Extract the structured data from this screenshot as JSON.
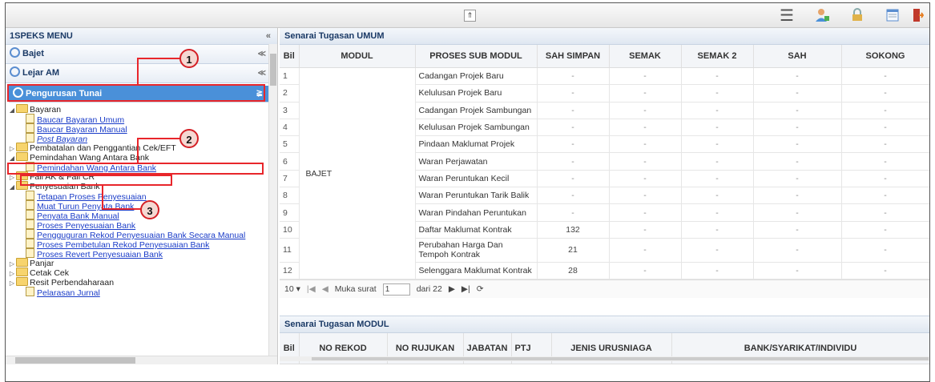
{
  "sidebar": {
    "title": "1SPEKS MENU",
    "collapse_glyph": "«",
    "accordions": [
      {
        "label": "Bajet",
        "icon": "search-icon"
      },
      {
        "label": "Lejar AM",
        "icon": "search-icon"
      },
      {
        "label": "Pengurusan Tunai",
        "icon": "search-icon"
      }
    ],
    "tree": [
      {
        "label": "Bayaran",
        "type": "folder",
        "level": 1,
        "expanded": true
      },
      {
        "label": "Baucar Bayaran Umum",
        "type": "doc",
        "level": 2
      },
      {
        "label": "Baucar Bayaran Manual",
        "type": "doc",
        "level": 2
      },
      {
        "label": "Post Bayaran",
        "type": "doc",
        "level": 2,
        "italic": true
      },
      {
        "label": "Pembatalan dan Penggantian Cek/EFT",
        "type": "folder",
        "level": 1,
        "expanded": false
      },
      {
        "label": "Pemindahan Wang Antara Bank",
        "type": "folder",
        "level": 1,
        "expanded": true
      },
      {
        "label": "Pemindahan Wang Antara Bank",
        "type": "doc",
        "level": 2
      },
      {
        "label": "Fail AK & Fail CR",
        "type": "folder",
        "level": 1,
        "expanded": false
      },
      {
        "label": "Penyesuaian Bank",
        "type": "folder",
        "level": 1,
        "expanded": true
      },
      {
        "label": "Tetapan Proses Penyesuaian",
        "type": "doc",
        "level": 2
      },
      {
        "label": "Muat Turun Penyata Bank",
        "type": "doc",
        "level": 2
      },
      {
        "label": "Penyata Bank Manual",
        "type": "doc",
        "level": 2
      },
      {
        "label": "Proses Penyesuaian Bank",
        "type": "doc",
        "level": 2
      },
      {
        "label": "Pengguguran Rekod Penyesuaian Bank Secara Manual",
        "type": "doc",
        "level": 2
      },
      {
        "label": "Proses Pembetulan Rekod Penyesuaian Bank",
        "type": "doc",
        "level": 2
      },
      {
        "label": "Proses Revert Penyesuaian Bank",
        "type": "doc",
        "level": 2
      },
      {
        "label": "Panjar",
        "type": "folder",
        "level": 1,
        "expanded": false
      },
      {
        "label": "Cetak Cek",
        "type": "folder",
        "level": 1,
        "expanded": false
      },
      {
        "label": "Resit Perbendaharaan",
        "type": "folder",
        "level": 1,
        "expanded": false
      },
      {
        "label": "Pelarasan Jurnal",
        "type": "doc",
        "level": 2
      }
    ]
  },
  "topbar": {
    "collapse_glyph": "⇑",
    "icons": [
      "menu-icon",
      "user-icon",
      "lock-icon",
      "window-icon",
      "logout-icon"
    ]
  },
  "umum": {
    "title": "Senarai Tugasan UMUM",
    "columns": [
      "Bil",
      "MODUL",
      "PROSES SUB MODUL",
      "SAH SIMPAN",
      "SEMAK",
      "SEMAK 2",
      "SAH",
      "SOKONG"
    ],
    "module": "BAJET",
    "rows": [
      {
        "bil": "1",
        "proses": "Cadangan Projek Baru",
        "simpan": "-",
        "semak": "-",
        "semak2": "-",
        "sah": "-",
        "sokong": "-"
      },
      {
        "bil": "2",
        "proses": "Kelulusan Projek Baru",
        "simpan": "-",
        "semak": "-",
        "semak2": "-",
        "sah": "-",
        "sokong": "-"
      },
      {
        "bil": "3",
        "proses": "Cadangan Projek Sambungan",
        "simpan": "-",
        "semak": "-",
        "semak2": "-",
        "sah": "-",
        "sokong": "-"
      },
      {
        "bil": "4",
        "proses": "Kelulusan Projek Sambungan",
        "simpan": "-",
        "semak": "-",
        "semak2": "-",
        "sah": "-",
        "sokong": "-"
      },
      {
        "bil": "5",
        "proses": "Pindaan Maklumat Projek",
        "simpan": "-",
        "semak": "-",
        "semak2": "-",
        "sah": "-",
        "sokong": "-"
      },
      {
        "bil": "6",
        "proses": "Waran Perjawatan",
        "simpan": "-",
        "semak": "-",
        "semak2": "-",
        "sah": "-",
        "sokong": "-"
      },
      {
        "bil": "7",
        "proses": "Waran Peruntukan Kecil",
        "simpan": "-",
        "semak": "-",
        "semak2": "-",
        "sah": "-",
        "sokong": "-"
      },
      {
        "bil": "8",
        "proses": "Waran Peruntukan Tarik Balik",
        "simpan": "-",
        "semak": "-",
        "semak2": "-",
        "sah": "-",
        "sokong": "-"
      },
      {
        "bil": "9",
        "proses": "Waran Pindahan Peruntukan",
        "simpan": "-",
        "semak": "-",
        "semak2": "-",
        "sah": "-",
        "sokong": "-"
      },
      {
        "bil": "10",
        "proses": "Daftar Maklumat Kontrak",
        "simpan": "132",
        "semak": "-",
        "semak2": "-",
        "sah": "-",
        "sokong": "-"
      },
      {
        "bil": "11",
        "proses": "Perubahan Harga Dan Tempoh Kontrak",
        "simpan": "21",
        "semak": "-",
        "semak2": "-",
        "sah": "-",
        "sokong": "-"
      },
      {
        "bil": "12",
        "proses": "Selenggara Maklumat Kontrak",
        "simpan": "28",
        "semak": "-",
        "semak2": "-",
        "sah": "-",
        "sokong": "-"
      }
    ],
    "pager": {
      "page_size": "10",
      "page_label": "Muka surat",
      "page": "1",
      "of_label": "dari 22"
    }
  },
  "modul": {
    "title": "Senarai Tugasan MODUL",
    "columns": [
      "Bil",
      "NO REKOD",
      "NO RUJUKAN",
      "JABATAN",
      "PTJ",
      "JENIS URUSNIAGA",
      "BANK/SYARIKAT/INDIVIDU"
    ]
  },
  "annotations": [
    "1",
    "2",
    "3"
  ],
  "colors": {
    "accent": "#4a90d9",
    "highlight": "#e8262b",
    "link": "#1a3cc8"
  }
}
